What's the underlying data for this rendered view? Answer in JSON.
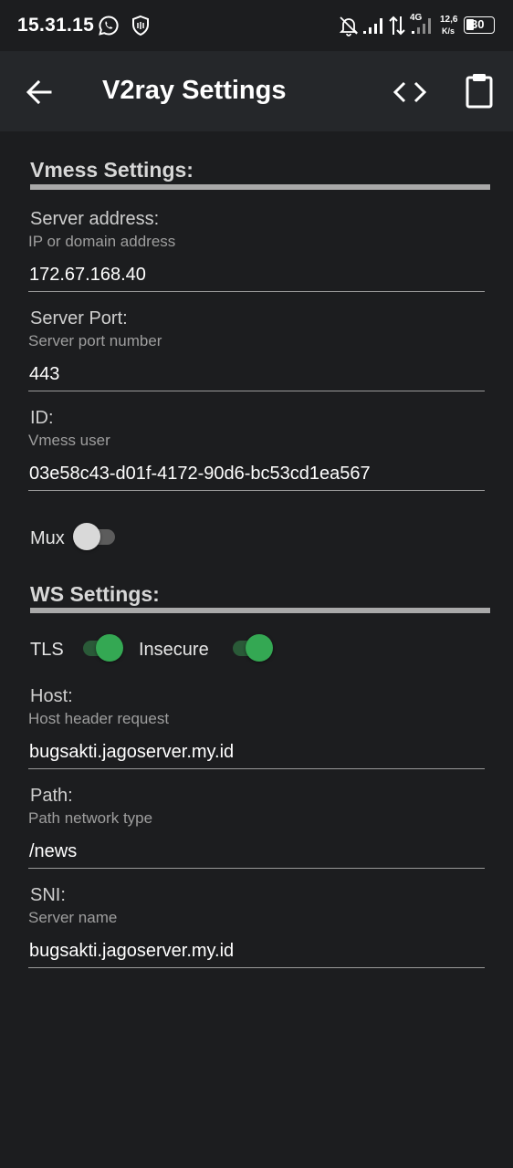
{
  "status_bar": {
    "time": "15.31.15",
    "network_type": "4G",
    "speed_value": "12,6",
    "speed_unit": "K/s",
    "battery": "30",
    "icons": [
      "whatsapp-icon",
      "shield-icon",
      "mute-bell-icon",
      "signal-icon",
      "data-arrows-icon",
      "signal-4g-icon",
      "battery-icon"
    ]
  },
  "app_bar": {
    "title": "V2ray Settings",
    "icons": [
      "back-arrow-icon",
      "code-icon",
      "clipboard-icon"
    ]
  },
  "vmess": {
    "section_title": "Vmess Settings:",
    "server_address": {
      "label": "Server address:",
      "hint": "IP or domain address",
      "value": "172.67.168.40"
    },
    "server_port": {
      "label": "Server Port:",
      "hint": "Server port number",
      "value": "443"
    },
    "id": {
      "label": "ID:",
      "hint": "Vmess user",
      "value": "03e58c43-d01f-4172-90d6-bc53cd1ea567"
    },
    "mux": {
      "label": "Mux",
      "enabled": false
    }
  },
  "ws": {
    "section_title": "WS Settings:",
    "tls": {
      "label": "TLS",
      "enabled": true
    },
    "insecure": {
      "label": "Insecure",
      "enabled": true
    },
    "host": {
      "label": "Host:",
      "hint": "Host header request",
      "value": "bugsakti.jagoserver.my.id"
    },
    "path": {
      "label": "Path:",
      "hint": "Path network type",
      "value": "/news"
    },
    "sni": {
      "label": "SNI:",
      "hint": "Server name",
      "value": "bugsakti.jagoserver.my.id"
    }
  },
  "colors": {
    "background": "#1c1d1f",
    "app_bar": "#25272a",
    "switch_on": "#34a853",
    "switch_off": "#d9d9d9"
  }
}
